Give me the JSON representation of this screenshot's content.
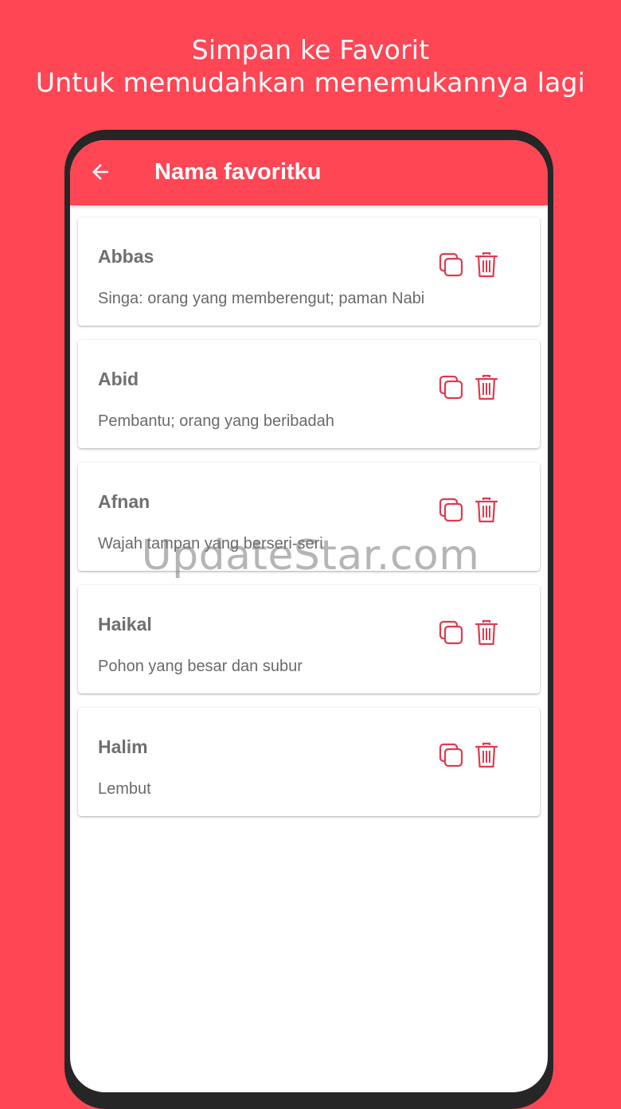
{
  "promo": {
    "line1": "Simpan ke Favorit",
    "line2": "Untuk memudahkan menemukannya lagi"
  },
  "appbar": {
    "title": "Nama favoritku",
    "back_icon": "arrow-left-icon"
  },
  "favorites": [
    {
      "name": "Abbas",
      "meaning": "Singa: orang yang memberengut; paman Nabi"
    },
    {
      "name": "Abid",
      "meaning": "Pembantu; orang yang beribadah"
    },
    {
      "name": "Afnan",
      "meaning": "Wajah tampan yang berseri-seri"
    },
    {
      "name": "Haikal",
      "meaning": "Pohon yang besar dan subur"
    },
    {
      "name": "Halim",
      "meaning": "Lembut"
    }
  ],
  "icons": {
    "copy": "copy-icon",
    "delete": "trash-icon"
  },
  "colors": {
    "accent": "#fe4655",
    "icon": "#e03a4e",
    "phone_frame": "#262626"
  },
  "watermark": "UpdateStar.com"
}
